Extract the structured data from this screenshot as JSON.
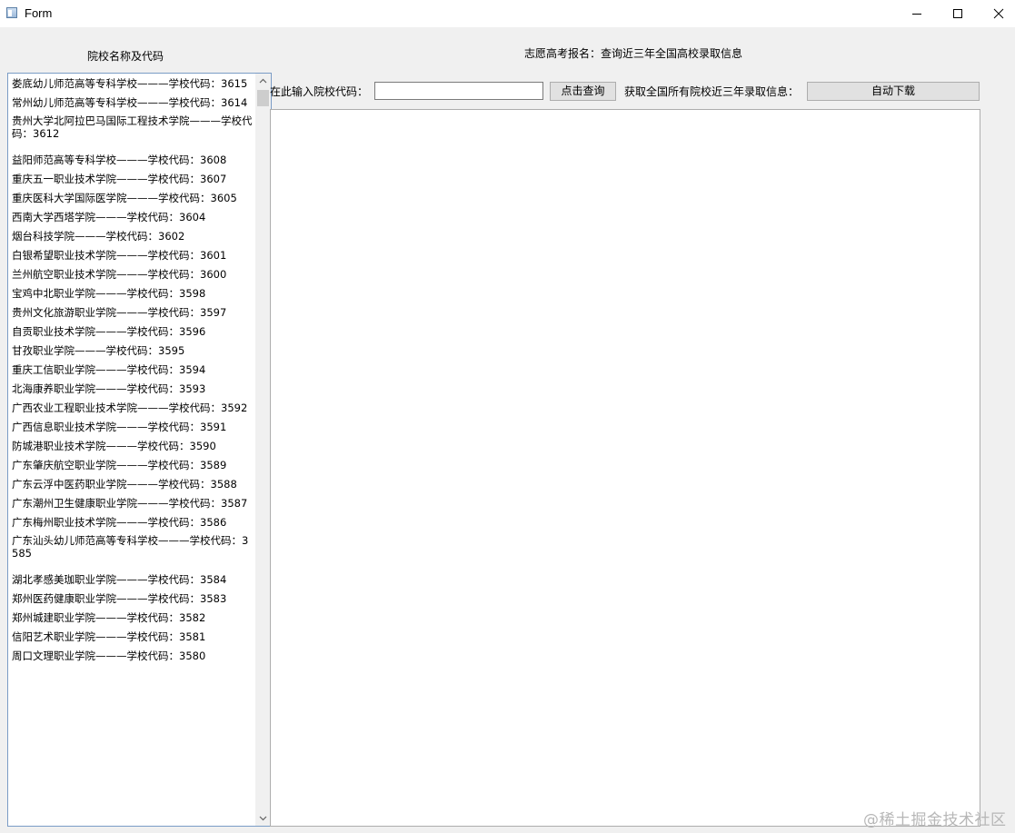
{
  "window": {
    "title": "Form"
  },
  "left_panel": {
    "title": "院校名称及代码",
    "items": [
      {
        "text": "娄底幼儿师范高等专科学校———学校代码：3615"
      },
      {
        "text": "常州幼儿师范高等专科学校———学校代码：3614"
      },
      {
        "text": "贵州大学北阿拉巴马国际工程技术学院———学校代码：3612"
      },
      {
        "text": "益阳师范高等专科学校———学校代码：3608"
      },
      {
        "text": "重庆五一职业技术学院———学校代码：3607"
      },
      {
        "text": "重庆医科大学国际医学院———学校代码：3605"
      },
      {
        "text": "西南大学西塔学院———学校代码：3604"
      },
      {
        "text": "烟台科技学院———学校代码：3602"
      },
      {
        "text": "白银希望职业技术学院———学校代码：3601"
      },
      {
        "text": "兰州航空职业技术学院———学校代码：3600"
      },
      {
        "text": "宝鸡中北职业学院———学校代码：3598"
      },
      {
        "text": "贵州文化旅游职业学院———学校代码：3597"
      },
      {
        "text": "自贡职业技术学院———学校代码：3596"
      },
      {
        "text": "甘孜职业学院———学校代码：3595"
      },
      {
        "text": "重庆工信职业学院———学校代码：3594"
      },
      {
        "text": "北海康养职业学院———学校代码：3593"
      },
      {
        "text": "广西农业工程职业技术学院———学校代码：3592"
      },
      {
        "text": "广西信息职业技术学院———学校代码：3591"
      },
      {
        "text": "防城港职业技术学院———学校代码：3590"
      },
      {
        "text": "广东肇庆航空职业学院———学校代码：3589"
      },
      {
        "text": "广东云浮中医药职业学院———学校代码：3588"
      },
      {
        "text": "广东潮州卫生健康职业学院———学校代码：3587"
      },
      {
        "text": "广东梅州职业技术学院———学校代码：3586"
      },
      {
        "text": "广东汕头幼儿师范高等专科学校———学校代码：3585"
      },
      {
        "text": "湖北孝感美珈职业学院———学校代码：3584"
      },
      {
        "text": "郑州医药健康职业学院———学校代码：3583"
      },
      {
        "text": "郑州城建职业学院———学校代码：3582"
      },
      {
        "text": "信阳艺术职业学院———学校代码：3581"
      },
      {
        "text": "周口文理职业学院———学校代码：3580"
      }
    ]
  },
  "header": {
    "title": "志愿高考报名：查询近三年全国高校录取信息"
  },
  "query": {
    "label": "在此输入院校代码：",
    "input_value": "",
    "button_label": "点击查询"
  },
  "fetch": {
    "label": "获取全国所有院校近三年录取信息：",
    "button_label": "自动下载"
  },
  "watermark": "@稀土掘金技术社区"
}
